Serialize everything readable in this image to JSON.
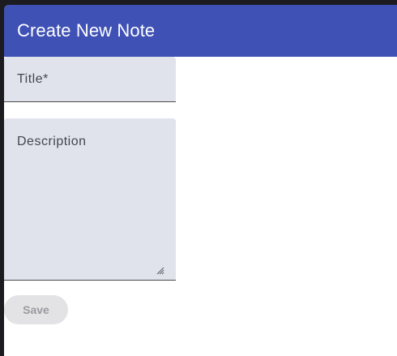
{
  "dialog": {
    "title": "Create New Note"
  },
  "form": {
    "title_label": "Title*",
    "description_label": "Description",
    "save_label": "Save"
  },
  "colors": {
    "header": "#3f51b5",
    "field_background": "#e1e3ec",
    "button_disabled_background": "#e3e3e6",
    "button_disabled_text": "#9a9aa0"
  }
}
